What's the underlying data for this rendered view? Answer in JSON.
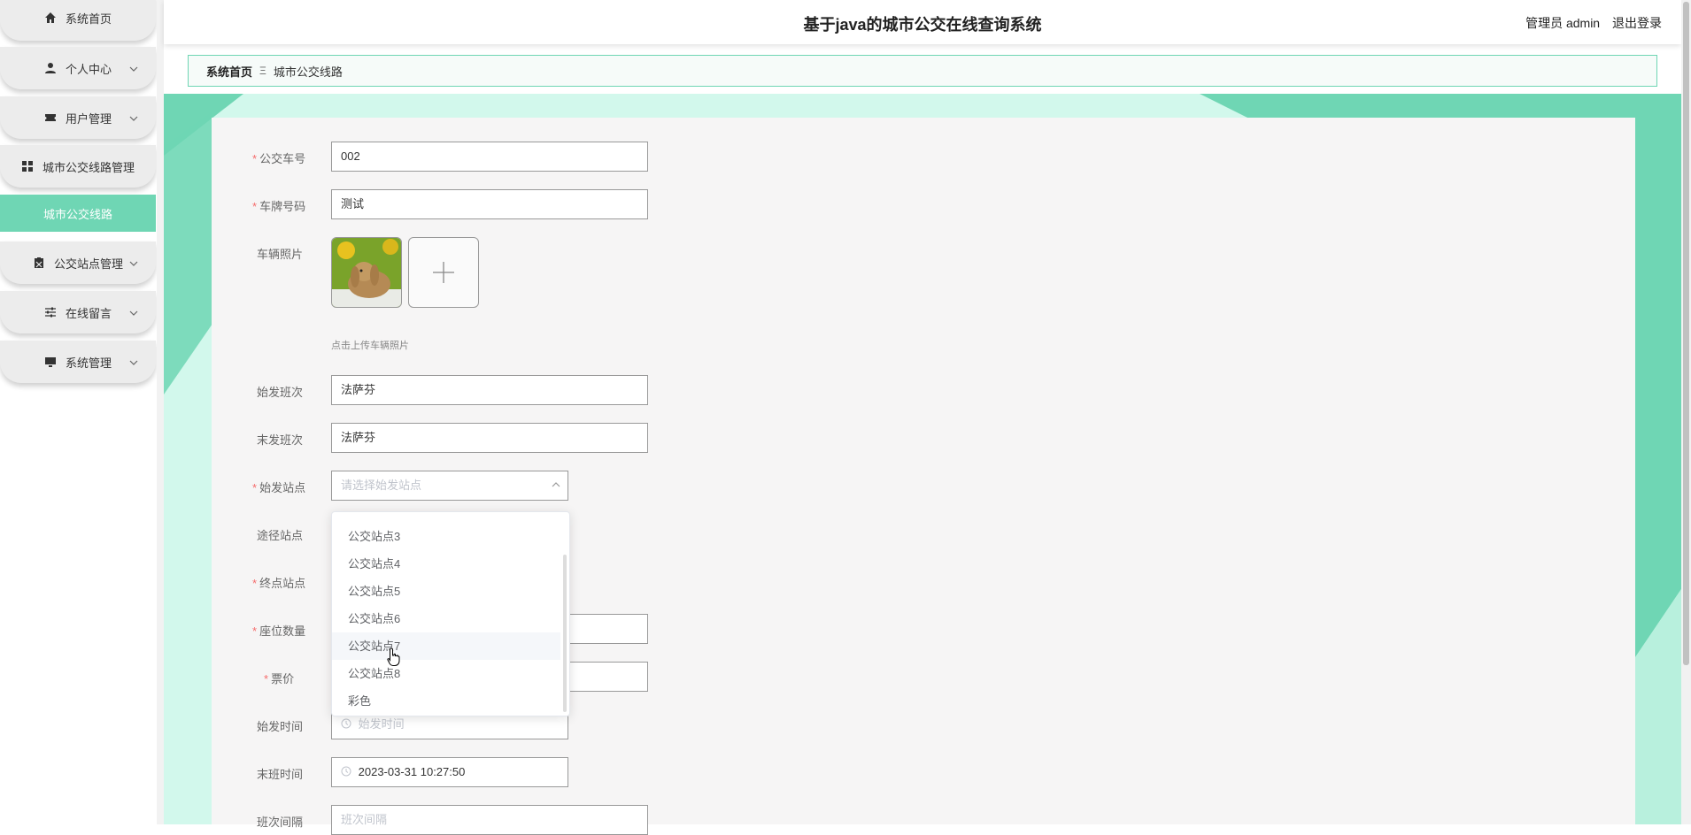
{
  "app": {
    "title": "基于java的城市公交在线查询系统",
    "admin_label": "管理员 admin",
    "logout_label": "退出登录"
  },
  "sidebar": {
    "items": [
      {
        "label": "系统首页",
        "icon": "home-icon"
      },
      {
        "label": "个人中心",
        "icon": "user-icon"
      },
      {
        "label": "用户管理",
        "icon": "ticket-icon"
      },
      {
        "label": "城市公交线路管理",
        "icon": "grid-icon"
      },
      {
        "label": "城市公交线路",
        "active": true
      },
      {
        "label": "公交站点管理",
        "icon": "clipboard-icon"
      },
      {
        "label": "在线留言",
        "icon": "sliders-icon"
      },
      {
        "label": "系统管理",
        "icon": "monitor-icon"
      }
    ]
  },
  "breadcrumb": {
    "home": "系统首页",
    "separator": "Ξ",
    "current": "城市公交线路"
  },
  "form": {
    "bus_number": {
      "label": "公交车号",
      "value": "002",
      "required": true
    },
    "plate_number": {
      "label": "车牌号码",
      "value": "测试",
      "required": true
    },
    "vehicle_photo": {
      "label": "车辆照片",
      "tip": "点击上传车辆照片"
    },
    "first_shift": {
      "label": "始发班次",
      "value": "法萨芬"
    },
    "last_shift": {
      "label": "末发班次",
      "value": "法萨芬"
    },
    "start_station": {
      "label": "始发站点",
      "placeholder": "请选择始发站点",
      "required": true
    },
    "via_station": {
      "label": "途径站点"
    },
    "end_station": {
      "label": "终点站点",
      "required": true
    },
    "seat_count": {
      "label": "座位数量",
      "required": true
    },
    "fare": {
      "label": "票价",
      "required": true
    },
    "start_time": {
      "label": "始发时间",
      "placeholder": "始发时间"
    },
    "last_time": {
      "label": "末班时间",
      "value": "2023-03-31 10:27:50"
    },
    "interval": {
      "label": "班次间隔",
      "placeholder": "班次间隔"
    }
  },
  "dropdown": {
    "options": [
      "公交站点3",
      "公交站点4",
      "公交站点5",
      "公交站点6",
      "公交站点7",
      "公交站点8",
      "彩色"
    ],
    "hovered": "公交站点7"
  },
  "colors": {
    "accent": "#6fd6b4",
    "accent_light": "#d2f8ec",
    "required": "#f56c6c"
  }
}
